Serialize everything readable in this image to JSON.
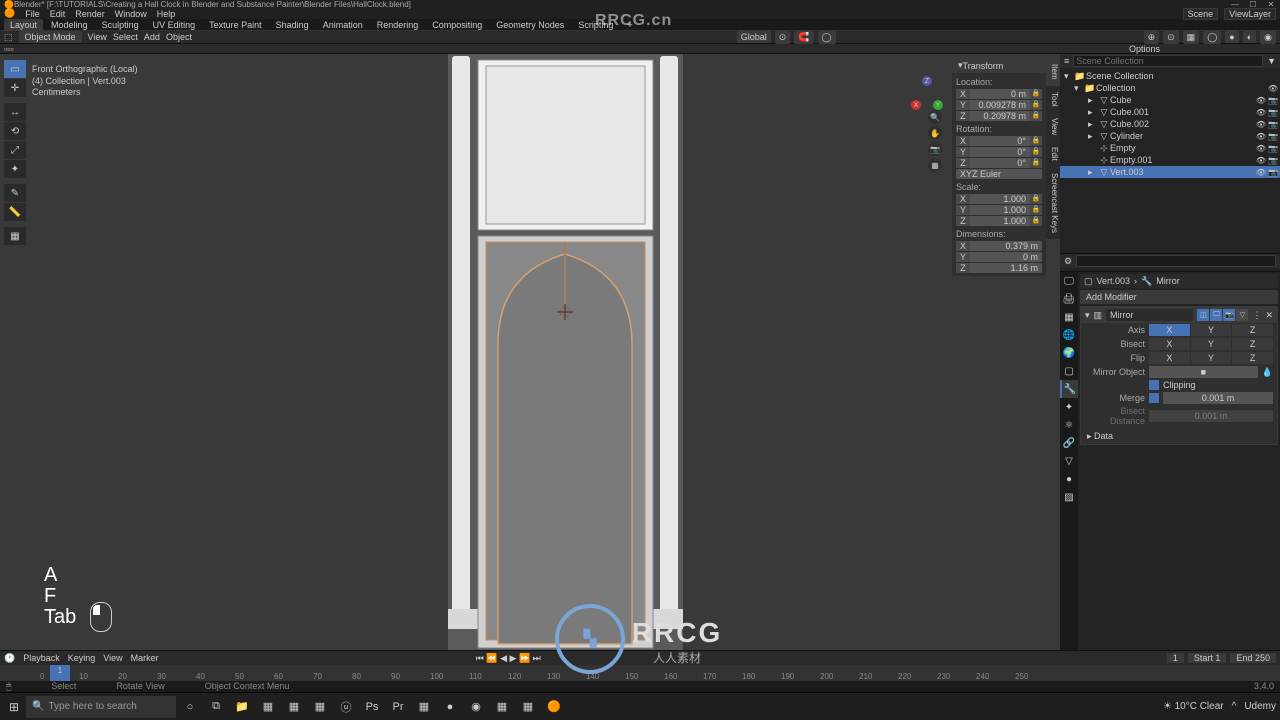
{
  "title": "Blender* [F:\\TUTORIALS\\Creating a Hall Clock in Blender and Substance Painter\\Blender Files\\HallClock.blend]",
  "menubar": [
    "File",
    "Edit",
    "Render",
    "Window",
    "Help"
  ],
  "workspaces": [
    "Layout",
    "Modeling",
    "Sculpting",
    "UV Editing",
    "Texture Paint",
    "Shading",
    "Animation",
    "Rendering",
    "Compositing",
    "Geometry Nodes",
    "Scripting",
    "+"
  ],
  "workspace_active": "Layout",
  "scene": {
    "scene_label": "Scene",
    "viewlayer_label": "ViewLayer"
  },
  "editor": {
    "mode": "Object Mode",
    "menus": [
      "View",
      "Select",
      "Add",
      "Object"
    ],
    "orientation": "Global",
    "options_label": "Options"
  },
  "viewport_info": {
    "line1": "Front Orthographic (Local)",
    "line2": "(4) Collection | Vert.003",
    "line3": "Centimeters"
  },
  "keys": [
    "A",
    "F",
    "Tab"
  ],
  "n_panel": {
    "header": "Transform",
    "location_label": "Location:",
    "rotation_label": "Rotation:",
    "scale_label": "Scale:",
    "dimensions_label": "Dimensions:",
    "rot_mode": "XYZ Euler",
    "loc": {
      "x": "0 m",
      "y": "0.009278 m",
      "z": "0.20978 m"
    },
    "rot": {
      "x": "0°",
      "y": "0°",
      "z": "0°"
    },
    "scale": {
      "x": "1.000",
      "y": "1.000",
      "z": "1.000"
    },
    "dim": {
      "x": "0.379 m",
      "y": "0 m",
      "z": "1.16 m"
    },
    "tabs": [
      "Item",
      "Tool",
      "View",
      "Edit",
      "Screencast Keys"
    ]
  },
  "outliner": {
    "root": "Scene Collection",
    "collection": "Collection",
    "items": [
      {
        "name": "Cube",
        "type": "mesh"
      },
      {
        "name": "Cube.001",
        "type": "mesh"
      },
      {
        "name": "Cube.002",
        "type": "mesh"
      },
      {
        "name": "Cylinder",
        "type": "mesh"
      },
      {
        "name": "Empty",
        "type": "empty"
      },
      {
        "name": "Empty.001",
        "type": "empty"
      },
      {
        "name": "Vert.003",
        "type": "mesh",
        "selected": true
      }
    ]
  },
  "properties": {
    "crumb_obj": "Vert.003",
    "crumb_mod": "Mirror",
    "add_modifier": "Add Modifier",
    "modifier": {
      "name": "Mirror",
      "axis_label": "Axis",
      "bisect_label": "Bisect",
      "flip_label": "Flip",
      "axis": {
        "x": true,
        "y": false,
        "z": false
      },
      "bisect": {
        "x": false,
        "y": false,
        "z": false
      },
      "flip": {
        "x": false,
        "y": false,
        "z": false
      },
      "mirror_object_label": "Mirror Object",
      "clipping_label": "Clipping",
      "clipping": true,
      "merge_label": "Merge",
      "merge_val": "0.001 m",
      "bisect_dist_label": "Bisect Distance",
      "bisect_dist": "0.001 m",
      "data_label": "Data"
    }
  },
  "timeline": {
    "menus": [
      "Playback",
      "Keying",
      "View",
      "Marker"
    ],
    "frame": 1,
    "start_label": "Start",
    "start": 1,
    "end_label": "End",
    "end": 250,
    "ticks": [
      0,
      10,
      20,
      30,
      40,
      50,
      60,
      70,
      80,
      90,
      100,
      110,
      120,
      130,
      140,
      150,
      160,
      170,
      180,
      190,
      200,
      210,
      220,
      230,
      240,
      250
    ]
  },
  "status": {
    "left1": "Select",
    "left2": "Rotate View",
    "left3": "Object Context Menu",
    "version": "3.4.0"
  },
  "taskbar": {
    "search_placeholder": "Type here to search",
    "weather": "10°C Clear",
    "udemy": "Udemy"
  },
  "watermark": {
    "top": "RRCG.cn",
    "big": "RRCG",
    "sub": "人人素材"
  }
}
